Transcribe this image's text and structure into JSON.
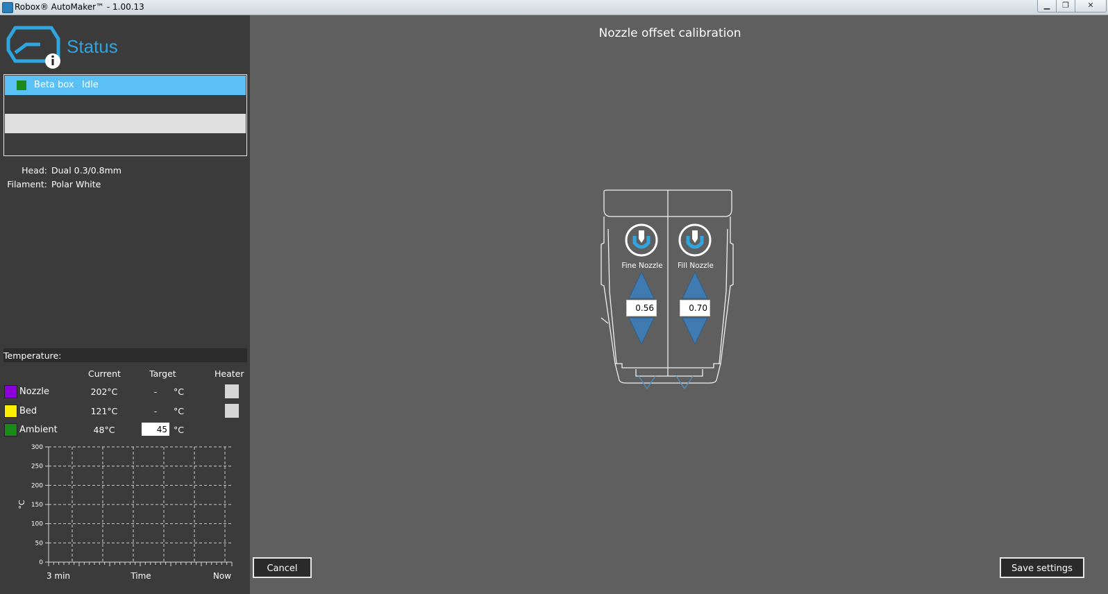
{
  "window": {
    "title": "Robox® AutoMaker™ - 1.00.13",
    "min_label": "▁",
    "max_label": "❐",
    "close_label": "✕"
  },
  "sidebar": {
    "section_title": "Status",
    "printers": [
      {
        "name": "Beta box",
        "status": "Idle",
        "color": "#1a8a1a"
      }
    ],
    "head_label": "Head:",
    "head_value": "Dual 0.3/0.8mm",
    "filament_label": "Filament:",
    "filament_value": "Polar White",
    "temperature": {
      "section_label": "Temperature:",
      "headers": {
        "current": "Current",
        "target": "Target",
        "heater": "Heater"
      },
      "rows": [
        {
          "name": "Nozzle",
          "color": "#8b00d8",
          "current": "202°C",
          "target": "-",
          "unit": "°C"
        },
        {
          "name": "Bed",
          "color": "#ffee00",
          "current": "121°C",
          "target": "-",
          "unit": "°C"
        },
        {
          "name": "Ambient",
          "color": "#1a8a1a",
          "current": "48°C",
          "target": "45",
          "unit": "°C"
        }
      ]
    }
  },
  "chart_data": {
    "type": "line",
    "title": "",
    "ylabel": "°C",
    "xlabel": "Time",
    "x_tick_labels": [
      "3 min",
      "Time",
      "Now"
    ],
    "y_ticks": [
      0,
      50,
      100,
      150,
      200,
      250,
      300
    ],
    "ylim": [
      0,
      300
    ],
    "grid": true,
    "series": []
  },
  "main": {
    "title": "Nozzle offset calibration",
    "nozzles": [
      {
        "label": "Fine Nozzle",
        "value": "0.56"
      },
      {
        "label": "Fill Nozzle",
        "value": "0.70"
      }
    ],
    "cancel_label": "Cancel",
    "save_label": "Save settings"
  }
}
